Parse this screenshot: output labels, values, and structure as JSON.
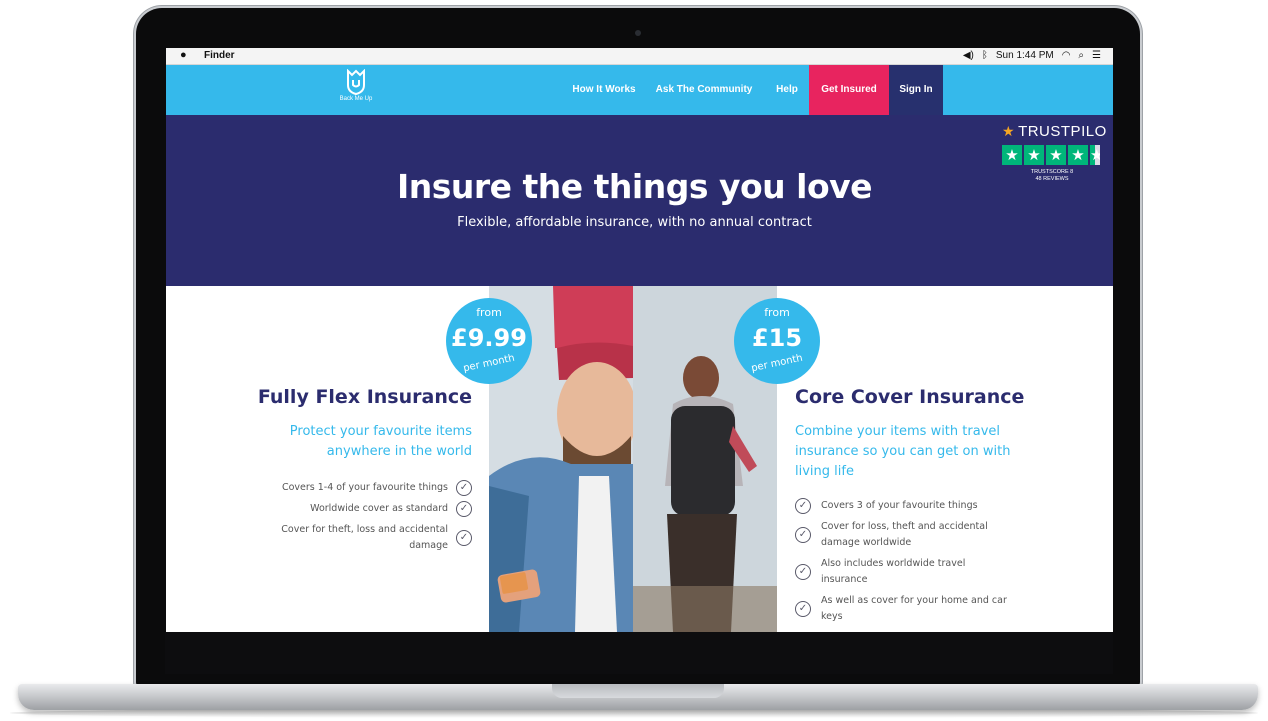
{
  "menubar": {
    "app_name": "Finder",
    "clock": "Sun 1:44 PM",
    "icons": [
      "apple-icon",
      "volume-icon",
      "bluetooth-icon",
      "wifi-icon",
      "spotlight-search-icon",
      "notification-center-icon"
    ]
  },
  "header": {
    "logo_text": "Back Me Up",
    "nav": {
      "how_it_works": "How It Works",
      "ask_community": "Ask The Community",
      "help": "Help",
      "get_insured": "Get Insured",
      "sign_in": "Sign In"
    },
    "colors": {
      "bar": "#35b9eb",
      "get_insured": "#e8245f",
      "sign_in": "#27306e"
    }
  },
  "hero": {
    "title": "Insure the things you love",
    "subtitle": "Flexible, affordable insurance, with no annual contract",
    "background": "#2b2c6e",
    "trustpilot": {
      "brand": "TRUSTPILO",
      "score_line1": "TRUSTSCORE 8",
      "score_line2": "48 REVIEWS"
    }
  },
  "products": {
    "flex": {
      "badge_from": "from",
      "badge_price": "£9.99",
      "badge_per": "per month",
      "title": "Fully Flex Insurance",
      "subtitle": "Protect your favourite items anywhere in the world",
      "features": [
        "Covers 1-4 of your favourite things",
        "Worldwide cover as standard",
        "Cover for theft, loss and accidental damage"
      ]
    },
    "core": {
      "badge_from": "from",
      "badge_price": "£15",
      "badge_per": "per month",
      "title": "Core Cover Insurance",
      "subtitle": "Combine your items with travel insurance so you can get on with living life",
      "features": [
        "Covers 3 of your favourite things",
        "Cover for loss, theft and accidental damage worldwide",
        "Also includes worldwide travel insurance",
        "As well as cover for your home and car keys"
      ]
    },
    "accent": "#35b9eb",
    "title_color": "#2b2c6e"
  }
}
